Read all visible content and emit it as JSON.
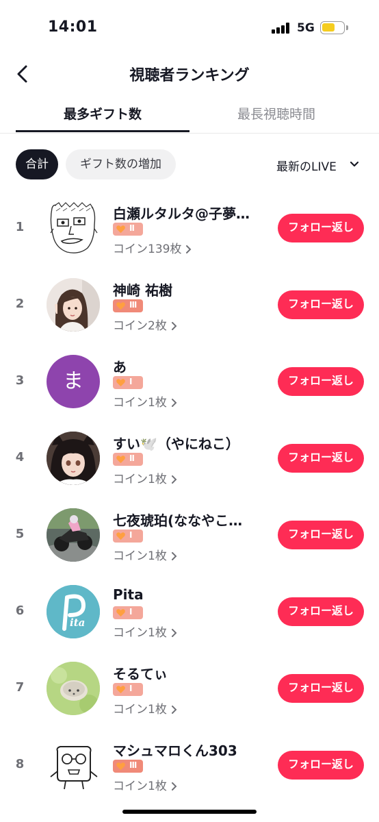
{
  "status_bar": {
    "time": "14:01",
    "network": "5G"
  },
  "header": {
    "title": "視聴者ランキング"
  },
  "tabs": [
    {
      "label": "最多ギフト数",
      "active": true
    },
    {
      "label": "最長視聴時間",
      "active": false
    }
  ],
  "filters": {
    "chips": [
      {
        "label": "合計",
        "selected": true
      },
      {
        "label": "ギフト数の増加",
        "selected": false
      }
    ],
    "sort_label": "最新のLIVE"
  },
  "viewers": [
    {
      "rank": "1",
      "name": "白瀬ルタルタ@子夢…",
      "level": "II",
      "coins": "コイン139枚",
      "action": "フォロー返し",
      "avatar": "sketch-face"
    },
    {
      "rank": "2",
      "name": "神崎 祐樹",
      "level": "III",
      "coins": "コイン2枚",
      "action": "フォロー返し",
      "avatar": "photo-girl"
    },
    {
      "rank": "3",
      "name": "あ",
      "level": "I",
      "coins": "コイン1枚",
      "action": "フォロー返し",
      "avatar": "letter",
      "avatar_letter": "ま"
    },
    {
      "rank": "4",
      "name": "すい🕊️（やにねこ）",
      "level": "II",
      "coins": "コイン1枚",
      "action": "フォロー返し",
      "avatar": "anime-cat-girl"
    },
    {
      "rank": "5",
      "name": "七夜琥珀(ななやこ…",
      "level": "I",
      "coins": "コイン1枚",
      "action": "フォロー返し",
      "avatar": "motorcycle"
    },
    {
      "rank": "6",
      "name": "Pita",
      "level": "I",
      "coins": "コイン1枚",
      "action": "フォロー返し",
      "avatar": "pita-logo",
      "avatar_text": "ita"
    },
    {
      "rank": "7",
      "name": "そるてぃ",
      "level": "I",
      "coins": "コイン1枚",
      "action": "フォロー返し",
      "avatar": "hedgehog"
    },
    {
      "rank": "8",
      "name": "マシュマロくん303",
      "level": "III",
      "coins": "コイン1枚",
      "action": "フォロー返し",
      "avatar": "doodle-glasses"
    }
  ],
  "colors": {
    "accent": "#fe2c55",
    "badge": "#f4a79a",
    "text_primary": "#161823",
    "text_secondary": "#6e6f75",
    "avatar_purple": "#8e44ad",
    "avatar_teal": "#5fb8c8"
  }
}
